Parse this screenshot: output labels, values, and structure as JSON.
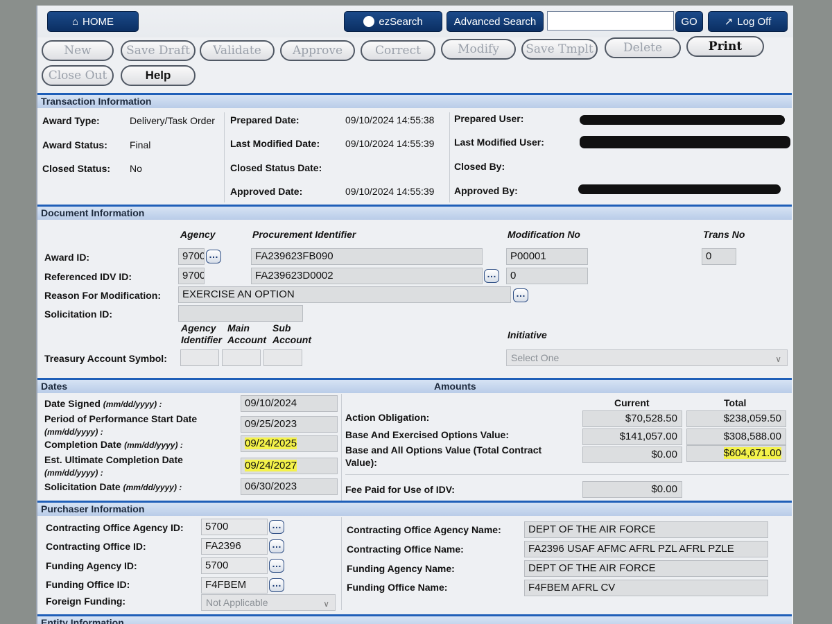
{
  "nav": {
    "home": "HOME",
    "ezsearch": "ezSearch",
    "advanced": "Advanced Search",
    "search_value": "",
    "go": "GO",
    "logoff": "Log Off"
  },
  "toolbar": {
    "new": "New",
    "save_draft": "Save Draft",
    "validate": "Validate",
    "approve": "Approve",
    "correct": "Correct",
    "modify": "Modify",
    "save_tmplt": "Save Tmplt",
    "delete": "Delete",
    "print": "Print",
    "close_out": "Close Out",
    "help": "Help"
  },
  "transaction": {
    "title": "Transaction Information",
    "award_type_label": "Award Type:",
    "award_type": "Delivery/Task Order",
    "award_status_label": "Award Status:",
    "award_status": "Final",
    "closed_status_label": "Closed Status:",
    "closed_status": "No",
    "prepared_date_label": "Prepared Date:",
    "prepared_date": "09/10/2024 14:55:38",
    "last_modified_date_label": "Last Modified Date:",
    "last_modified_date": "09/10/2024 14:55:39",
    "closed_status_date_label": "Closed Status Date:",
    "closed_status_date": "",
    "approved_date_label": "Approved Date:",
    "approved_date": "09/10/2024 14:55:39",
    "prepared_user_label": "Prepared User:",
    "last_modified_user_label": "Last Modified User:",
    "closed_by_label": "Closed By:",
    "closed_by": "",
    "approved_by_label": "Approved By:"
  },
  "document": {
    "title": "Document Information",
    "col_agency": "Agency",
    "col_procurement": "Procurement Identifier",
    "col_mod": "Modification No",
    "col_trans": "Trans No",
    "award_id_label": "Award ID:",
    "award_agency": "9700",
    "award_proc": "FA239623FB090",
    "award_mod": "P00001",
    "award_trans": "0",
    "ref_idv_label": "Referenced IDV ID:",
    "ref_agency": "9700",
    "ref_proc": "FA239623D0002",
    "ref_mod": "0",
    "reason_label": "Reason For Modification:",
    "reason": "EXERCISE AN OPTION",
    "solicitation_label": "Solicitation ID:",
    "solicitation": "",
    "col_agency_ident": "Agency Identifier",
    "col_main_acct": "Main Account",
    "col_sub_acct": "Sub Account",
    "col_initiative": "Initiative",
    "tas_label": "Treasury Account Symbol:",
    "initiative_select": "Select One"
  },
  "dates": {
    "title": "Dates",
    "date_signed_label": "Date Signed",
    "date_signed_fmt": "(mm/dd/yyyy) :",
    "date_signed": "09/10/2024",
    "pop_start_label": "Period of Performance Start Date",
    "pop_start_fmt": "(mm/dd/yyyy) :",
    "pop_start": "09/25/2023",
    "completion_label": "Completion Date",
    "completion_fmt": "(mm/dd/yyyy) :",
    "completion": "09/24/2025",
    "est_ult_label": "Est. Ultimate Completion Date",
    "est_ult_fmt": "(mm/dd/yyyy) :",
    "est_ult": "09/24/2027",
    "solicitation_date_label": "Solicitation Date",
    "solicitation_date_fmt": "(mm/dd/yyyy) :",
    "solicitation_date": "06/30/2023"
  },
  "amounts": {
    "title": "Amounts",
    "col_current": "Current",
    "col_total": "Total",
    "action_obligation_label": "Action Obligation:",
    "action_current": "$70,528.50",
    "action_total": "$238,059.50",
    "base_exercised_label": "Base And Exercised Options Value:",
    "exercised_current": "$141,057.00",
    "exercised_total": "$308,588.00",
    "base_all_label_1": "Base and All Options Value (Total Contract",
    "base_all_label_2": "Value):",
    "all_current": "$0.00",
    "all_total": "$604,671.00",
    "fee_label": "Fee Paid for Use of IDV:",
    "fee": "$0.00"
  },
  "purchaser": {
    "title": "Purchaser Information",
    "co_agency_id_label": "Contracting Office Agency ID:",
    "co_agency_id": "5700",
    "co_id_label": "Contracting Office ID:",
    "co_id": "FA2396",
    "funding_agency_id_label": "Funding Agency ID:",
    "funding_agency_id": "5700",
    "funding_office_id_label": "Funding Office ID:",
    "funding_office_id": "F4FBEM",
    "foreign_funding_label": "Foreign Funding:",
    "foreign_funding": "Not Applicable",
    "co_agency_name_label": "Contracting Office Agency Name:",
    "co_agency_name": "DEPT OF THE AIR FORCE",
    "co_name_label": "Contracting Office Name:",
    "co_name": "FA2396 USAF AFMC AFRL PZL AFRL PZLE",
    "funding_agency_name_label": "Funding Agency Name:",
    "funding_agency_name": "DEPT OF THE AIR FORCE",
    "funding_office_name_label": "Funding Office Name:",
    "funding_office_name": "F4FBEM AFRL CV"
  },
  "entity": {
    "title": "Entity Information"
  },
  "colors": {
    "nav_button": "#0b2f63",
    "section_bar": "#1f5fb8",
    "highlight": "#f4f24a"
  }
}
